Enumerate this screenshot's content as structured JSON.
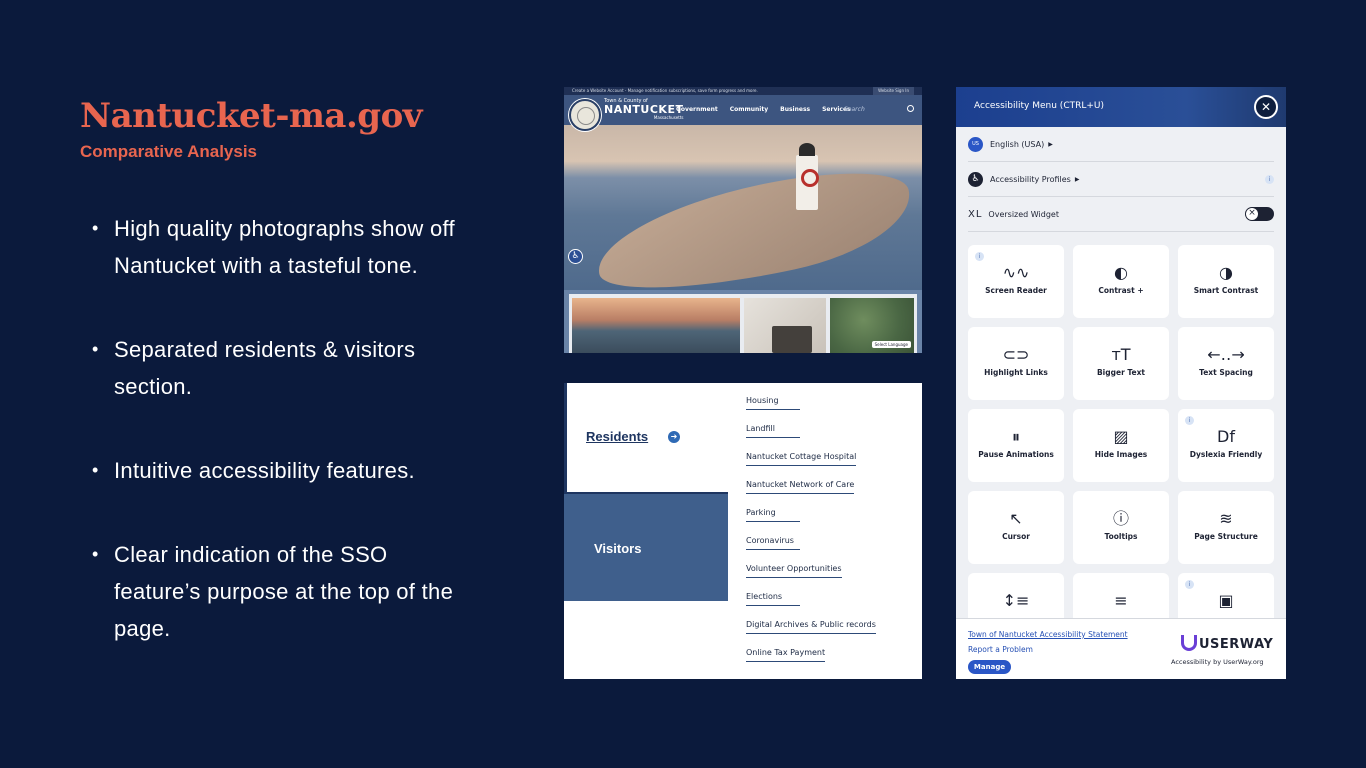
{
  "slide": {
    "title": "Nantucket-ma.gov",
    "subtitle": "Comparative Analysis",
    "bullets": [
      "High quality photographs show off Nantucket with a tasteful tone.",
      "Separated residents & visitors section.",
      "Intuitive accessibility features.",
      "Clear indication of the SSO feature’s purpose at the top of the page."
    ]
  },
  "website": {
    "topbar_text": "Create a Website Account - Manage notification subscriptions, save form progress and more.",
    "sign_in": "Website Sign In",
    "brand_small": "Town & County of",
    "brand_big": "NANTUCKET",
    "brand_state": "Massachusetts",
    "nav": [
      "Government",
      "Community",
      "Business",
      "Services"
    ],
    "search_placeholder": "Search",
    "select_language": "Select Language"
  },
  "sections": {
    "residents": "Residents",
    "visitors": "Visitors",
    "links": [
      "Housing",
      "Landfill",
      "Nantucket Cottage Hospital",
      "Nantucket Network of Care",
      "Parking",
      "Coronavirus",
      "Volunteer Opportunities",
      "Elections",
      "Digital Archives & Public records",
      "Online Tax Payment"
    ]
  },
  "a11y_menu": {
    "title": "Accessibility Menu (CTRL+U)",
    "language_code": "US",
    "language": "English (USA)",
    "profiles": "Accessibility Profiles",
    "oversized_prefix": "XL",
    "oversized": "Oversized Widget",
    "tiles": [
      {
        "label": "Screen Reader",
        "icon": "∿∿",
        "info": true
      },
      {
        "label": "Contrast +",
        "icon": "◐",
        "info": false
      },
      {
        "label": "Smart Contrast",
        "icon": "◑",
        "info": false
      },
      {
        "label": "Highlight Links",
        "icon": "⊂⊃",
        "info": false
      },
      {
        "label": "Bigger Text",
        "icon": "тТ",
        "info": false
      },
      {
        "label": "Text Spacing",
        "icon": "←‥→",
        "info": false
      },
      {
        "label": "Pause Animations",
        "icon": "⏸",
        "info": false
      },
      {
        "label": "Hide Images",
        "icon": "▨",
        "info": false
      },
      {
        "label": "Dyslexia Friendly",
        "icon": "Df",
        "info": true
      },
      {
        "label": "Cursor",
        "icon": "↖",
        "info": false
      },
      {
        "label": "Tooltips",
        "icon": "ⓘ",
        "info": false
      },
      {
        "label": "Page Structure",
        "icon": "≋",
        "info": false
      },
      {
        "label": "",
        "icon": "↕≡",
        "info": false
      },
      {
        "label": "",
        "icon": "≡",
        "info": false
      },
      {
        "label": "",
        "icon": "▣",
        "info": true
      }
    ],
    "statement_link": "Town of Nantucket Accessibility Statement",
    "report": "Report a Problem",
    "manage": "Manage",
    "brand": "USERWAY",
    "brand_sub": "Accessibility by UserWay.org"
  }
}
